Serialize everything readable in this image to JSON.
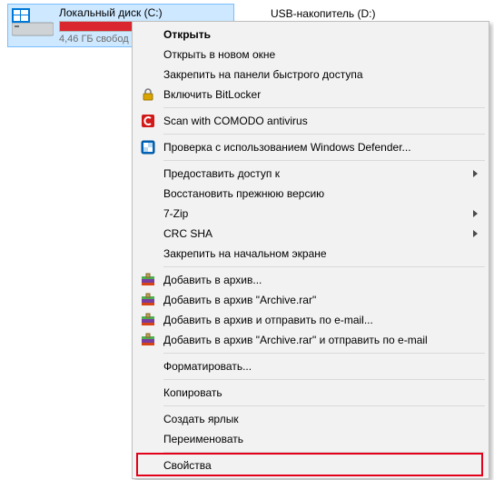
{
  "drives": {
    "c": {
      "label": "Локальный диск (C:)",
      "free": "4,46 ГБ свобод",
      "fill_pct": 92
    },
    "d": {
      "label": "USB-накопитель (D:)"
    }
  },
  "menu": {
    "open": "Открыть",
    "open_new_window": "Открыть в новом окне",
    "pin_quick_access": "Закрепить на панели быстрого доступа",
    "bitlocker": "Включить BitLocker",
    "comodo": "Scan with COMODO antivirus",
    "defender": "Проверка с использованием Windows Defender...",
    "share_access": "Предоставить доступ к",
    "restore_prev": "Восстановить прежнюю версию",
    "seven_zip": "7-Zip",
    "crc_sha": "CRC SHA",
    "pin_start": "Закрепить на начальном экране",
    "add_archive": "Добавить в архив...",
    "add_archive_rar": "Добавить в архив \"Archive.rar\"",
    "add_archive_email": "Добавить в архив и отправить по e-mail...",
    "add_archive_rar_email": "Добавить в архив \"Archive.rar\" и отправить по e-mail",
    "format": "Форматировать...",
    "copy": "Копировать",
    "create_shortcut": "Создать ярлык",
    "rename": "Переименовать",
    "properties": "Свойства"
  }
}
